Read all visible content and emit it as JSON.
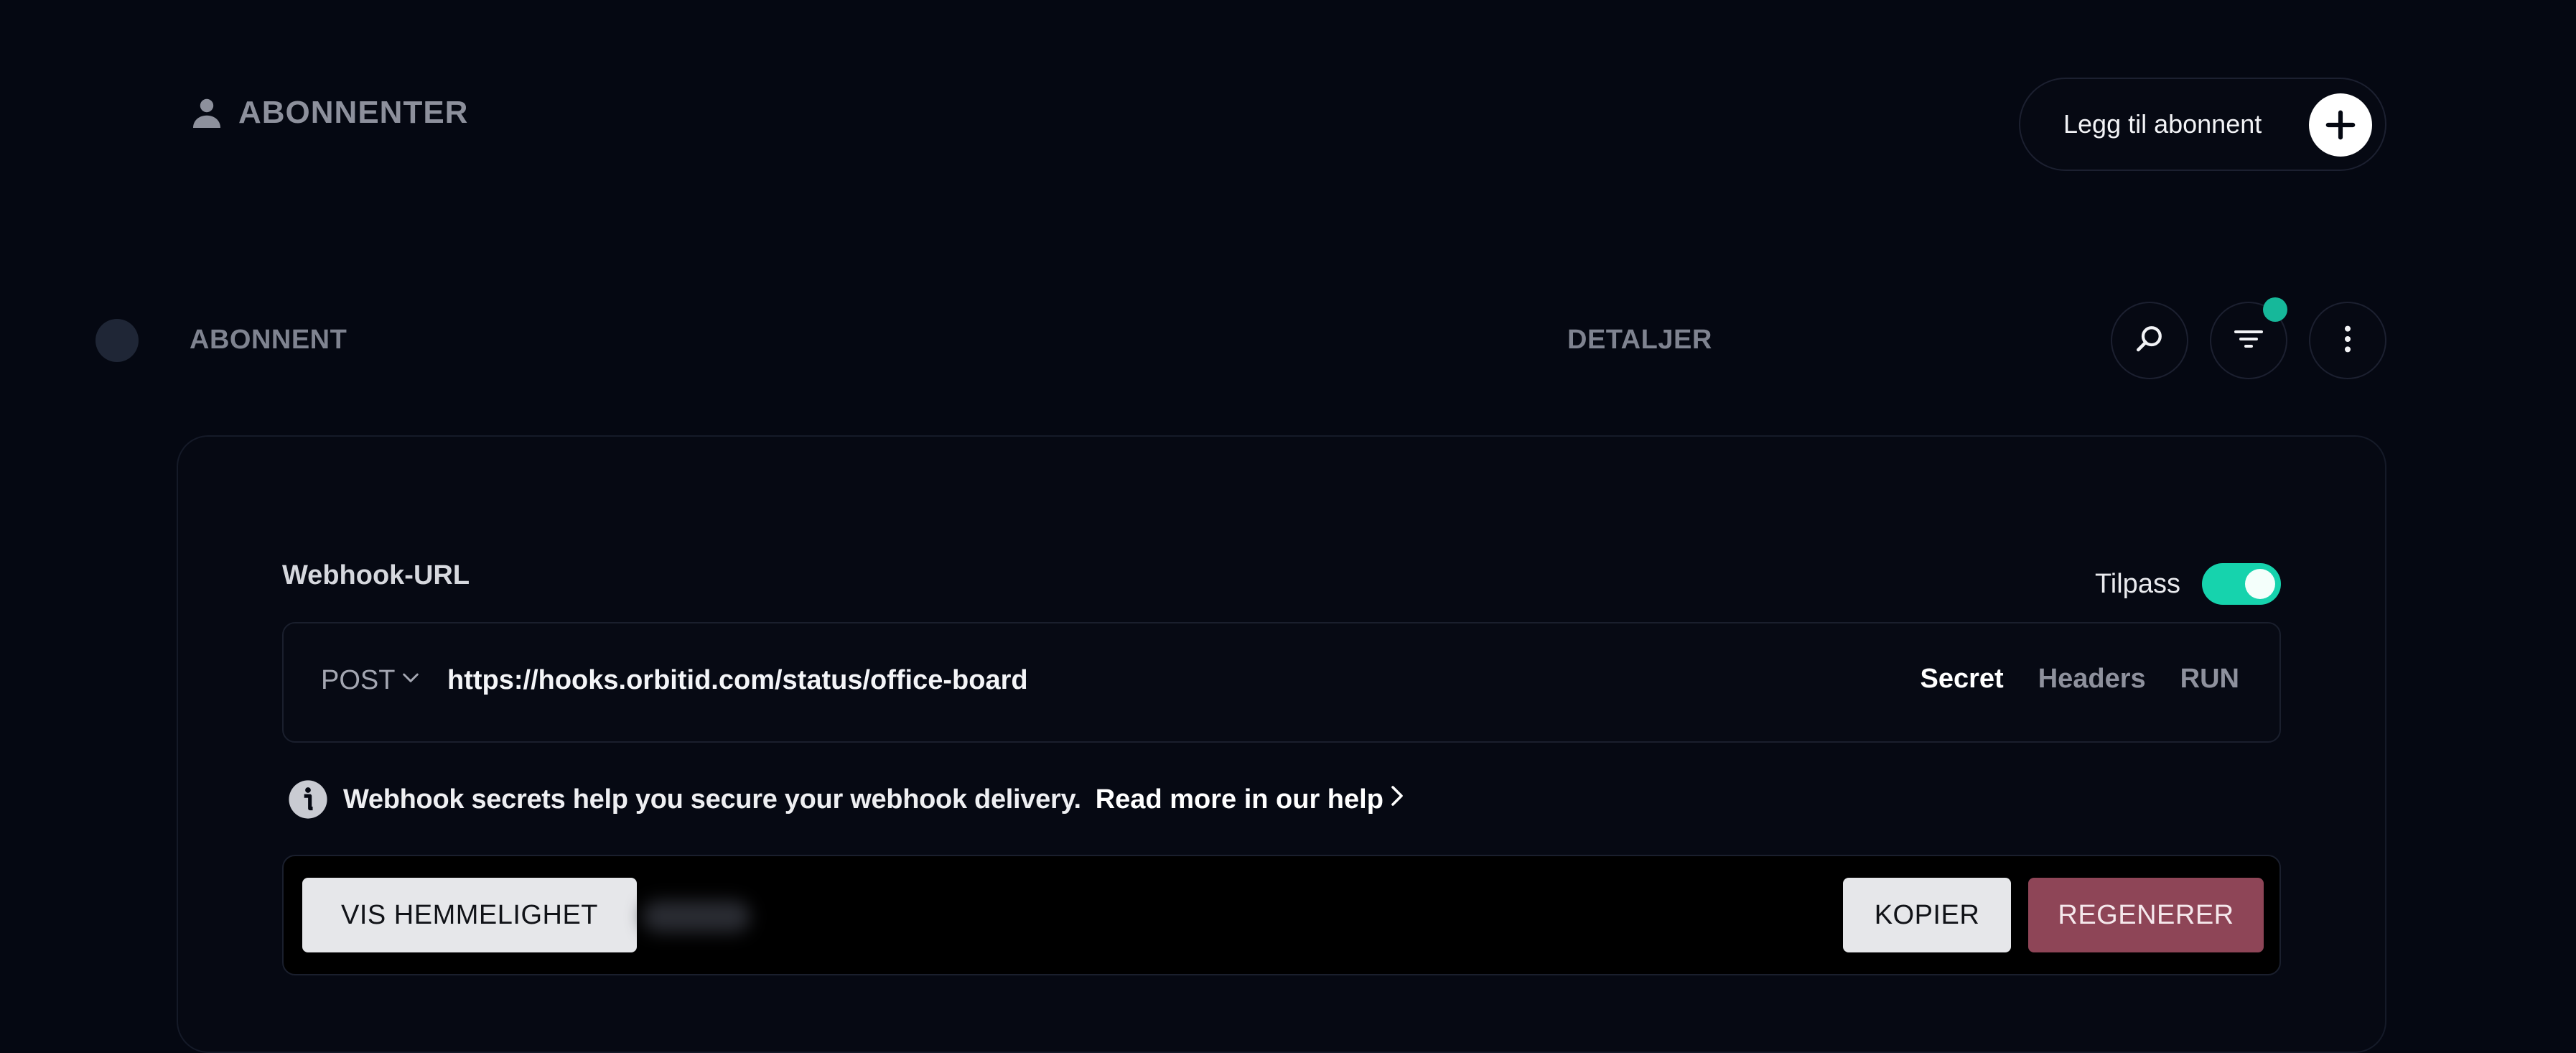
{
  "header": {
    "title": "ABONNENTER",
    "title_icon": "person-icon",
    "add_button_label": "Legg til abonnent",
    "add_button_icon": "plus-icon"
  },
  "table": {
    "columns": [
      "ABONNENT",
      "DETALJER"
    ],
    "tools": {
      "search_icon": "search-icon",
      "filter_icon": "filter-icon",
      "more_icon": "more-vertical-icon"
    }
  },
  "webhook": {
    "label": "Webhook-URL",
    "customize_label": "Tilpass",
    "customize_enabled": true,
    "method": "POST",
    "url": "https://hooks.orbitid.com/status/office-board",
    "tabs": [
      "Secret",
      "Headers",
      "RUN"
    ],
    "active_tab": "Secret",
    "info_text": "Webhook secrets help you secure your webhook delivery.",
    "help_link": "Read more in our help",
    "secret": {
      "show_label": "VIS HEMMELIGHET",
      "copy_label": "KOPIER",
      "regenerate_label": "REGENERER"
    }
  },
  "colors": {
    "background": "#050812",
    "accent": "#16d3ad",
    "filter_badge": "#16b89a",
    "danger": "#8e4557"
  }
}
